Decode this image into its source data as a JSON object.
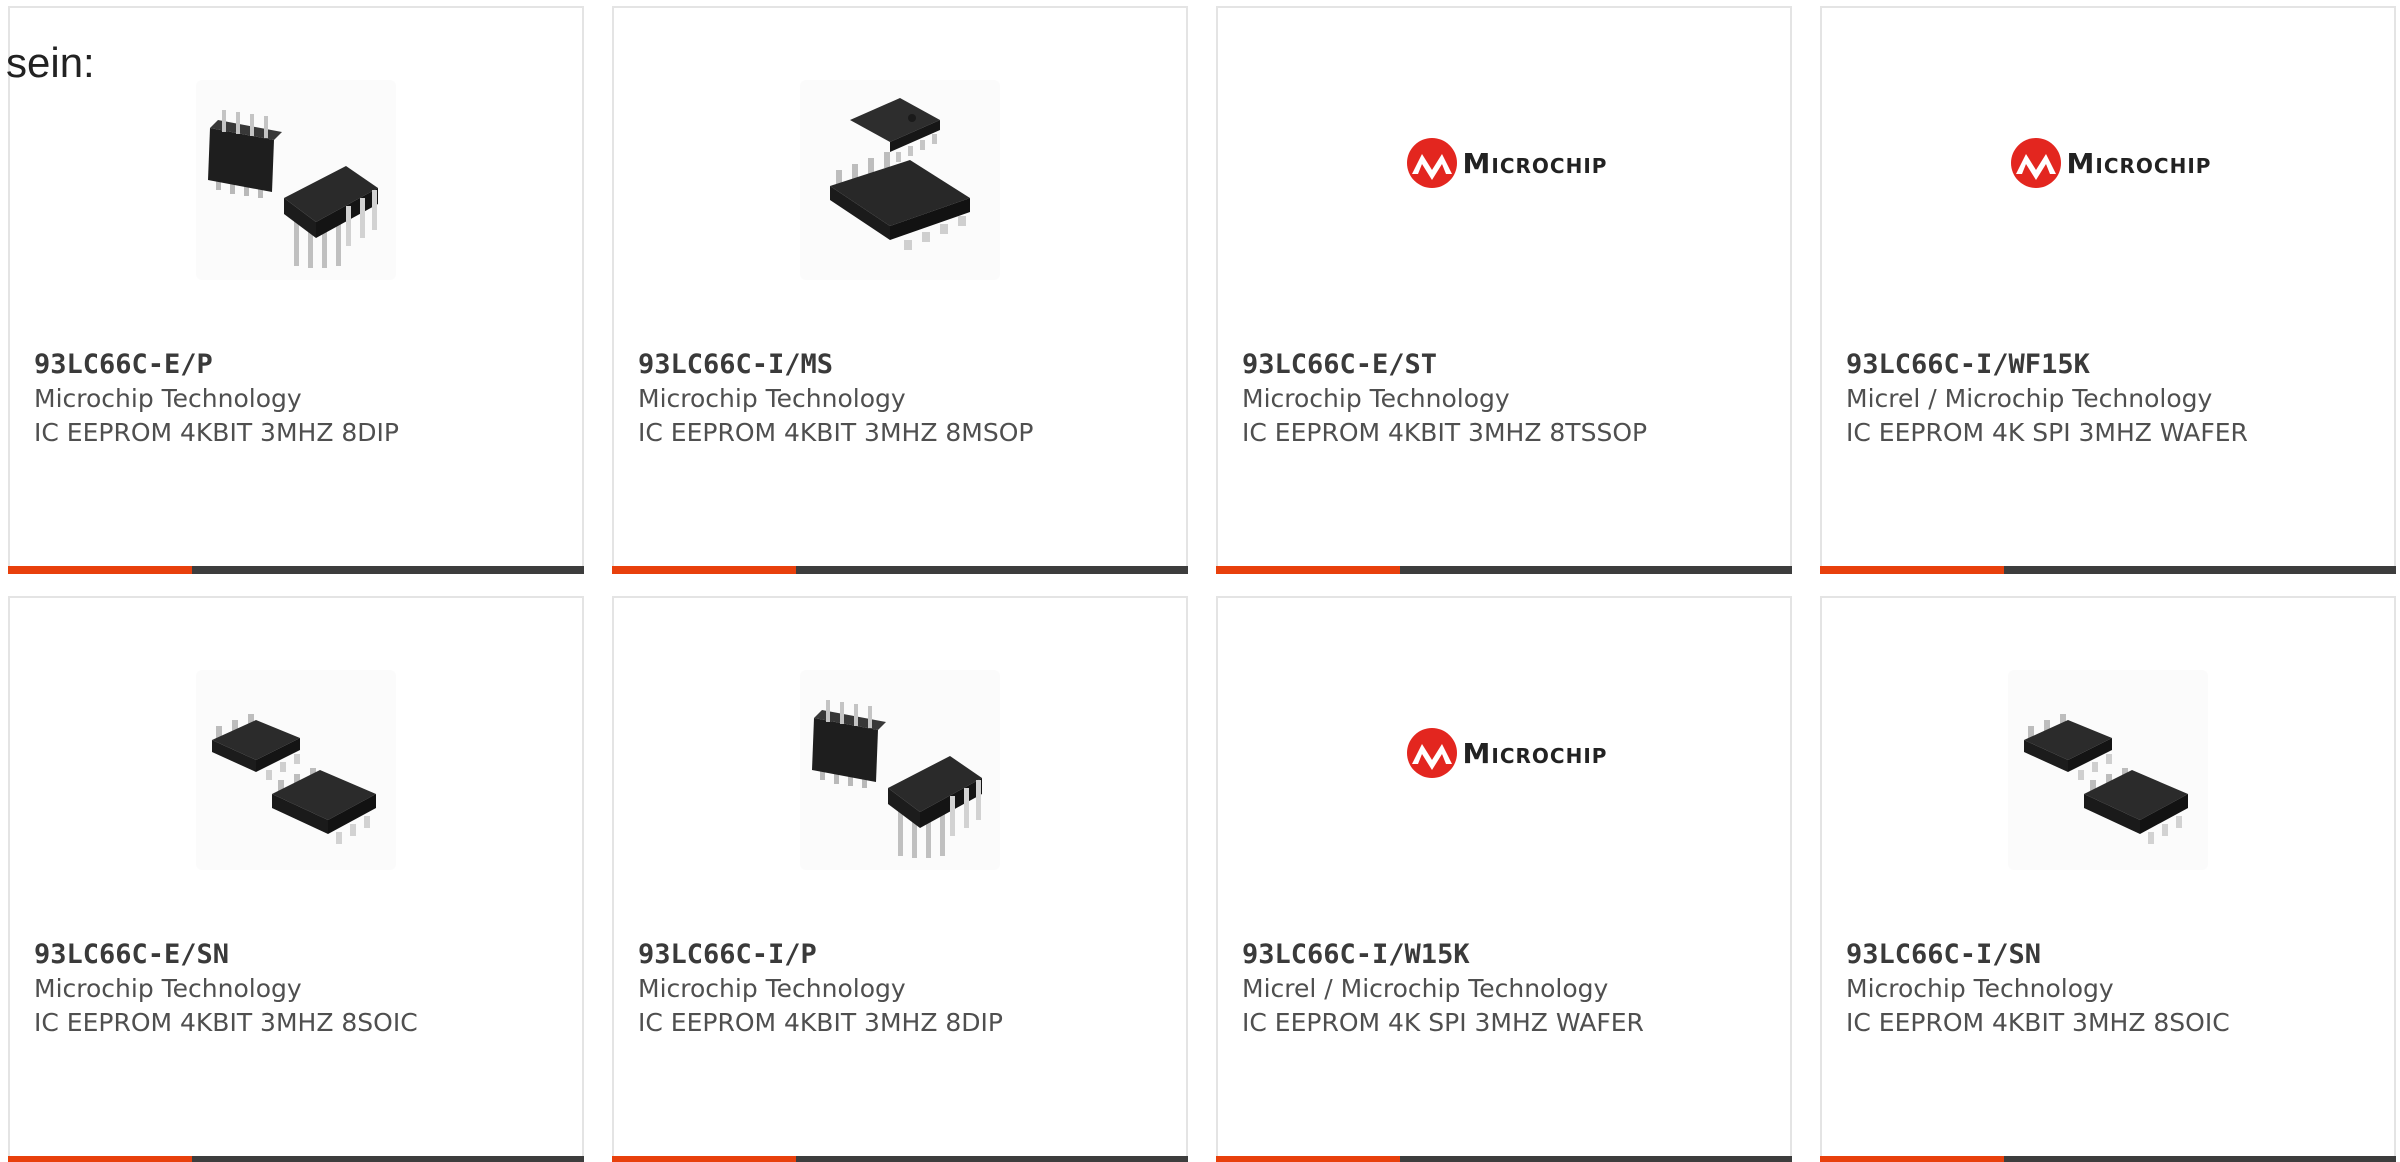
{
  "intro_text": "sein:",
  "colors": {
    "accent": "#e8400c",
    "bar_dark": "#3d3d3d",
    "brand_red": "#e3261f"
  },
  "cards": [
    {
      "part_number": "93LC66C-E/P",
      "manufacturer": "Microchip Technology",
      "description": "IC EEPROM 4KBIT 3MHZ 8DIP",
      "image": "dip-chip-image"
    },
    {
      "part_number": "93LC66C-I/MS",
      "manufacturer": "Microchip Technology",
      "description": "IC EEPROM 4KBIT 3MHZ 8MSOP",
      "image": "msop-chip-image"
    },
    {
      "part_number": "93LC66C-E/ST",
      "manufacturer": "Microchip Technology",
      "description": "IC EEPROM 4KBIT 3MHZ 8TSSOP",
      "image": "microchip-logo",
      "logo_text": "Microchip"
    },
    {
      "part_number": "93LC66C-I/WF15K",
      "manufacturer": "Micrel / Microchip Technology",
      "description": "IC EEPROM 4K SPI 3MHZ WAFER",
      "image": "microchip-logo",
      "logo_text": "Microchip"
    },
    {
      "part_number": "93LC66C-E/SN",
      "manufacturer": "Microchip Technology",
      "description": "IC EEPROM 4KBIT 3MHZ 8SOIC",
      "image": "soic-chip-image"
    },
    {
      "part_number": "93LC66C-I/P",
      "manufacturer": "Microchip Technology",
      "description": "IC EEPROM 4KBIT 3MHZ 8DIP",
      "image": "dip-chip-image"
    },
    {
      "part_number": "93LC66C-I/W15K",
      "manufacturer": "Micrel / Microchip Technology",
      "description": "IC EEPROM 4K SPI 3MHZ WAFER",
      "image": "microchip-logo",
      "logo_text": "Microchip"
    },
    {
      "part_number": "93LC66C-I/SN",
      "manufacturer": "Microchip Technology",
      "description": "IC EEPROM 4KBIT 3MHZ 8SOIC",
      "image": "soic-chip-image"
    }
  ]
}
